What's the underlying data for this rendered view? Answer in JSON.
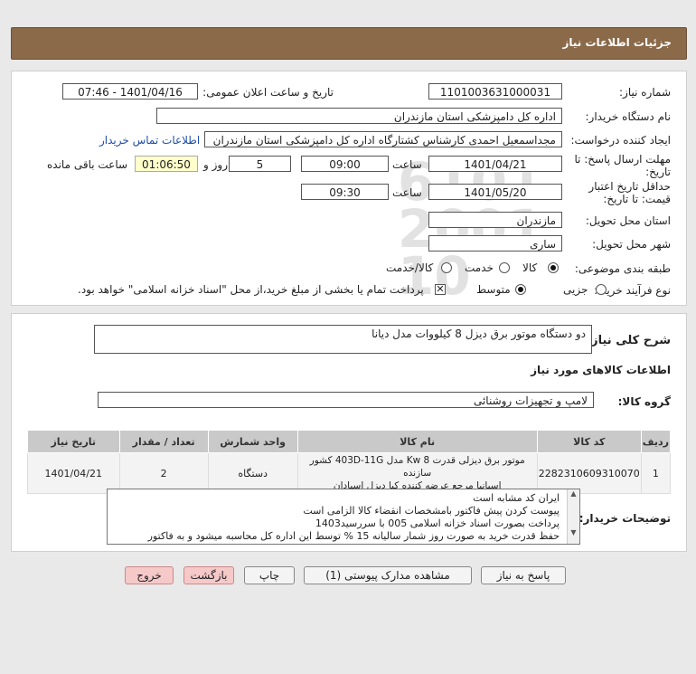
{
  "header": {
    "title": "جزئیات اطلاعات نیاز"
  },
  "form": {
    "need_number_label": "شماره نیاز:",
    "need_number": "1101003631000031",
    "announce_label": "تاریخ و ساعت اعلان عمومی:",
    "announce_value": "1401/04/16 - 07:46",
    "buyer_label": "نام دستگاه خریدار:",
    "buyer_value": "اداره کل دامپزشکی استان مازندران",
    "creator_label": "ایجاد کننده درخواست:",
    "creator_value": "مجداسمعیل احمدی کارشناس کشتارگاه اداره کل دامپزشکی استان مازندران",
    "contact_link": "اطلاعات تماس خریدار",
    "deadline_label_1": "مهلت ارسال پاسخ: تا",
    "deadline_label_2": "تاریخ:",
    "deadline_date": "1401/04/21",
    "time_label": "ساعت",
    "deadline_time": "09:00",
    "days_value": "5",
    "days_label": "روز و",
    "timer_value": "01:06:50",
    "remaining_label": "ساعت باقی مانده",
    "validity_label_1": "حداقل تاریخ اعتبار",
    "validity_label_2": "قیمت: تا تاریخ:",
    "validity_date": "1401/05/20",
    "validity_time": "09:30",
    "province_label": "استان محل تحویل:",
    "province_value": "مازندران",
    "city_label": "شهر محل تحویل:",
    "city_value": "ساری",
    "category_label": "طبقه بندی موضوعی:",
    "category_options": [
      "کالا",
      "خدمت",
      "کالا/خدمت"
    ],
    "process_label": "نوع فرآیند خرید :",
    "process_options": [
      "جزیی",
      "متوسط"
    ],
    "payment_note": "پرداخت تمام یا بخشی از مبلغ خرید،از محل \"اسناد خزانه اسلامی\" خواهد بود."
  },
  "summary": {
    "label": "شرح کلی نیاز:",
    "value": "دو دستگاه موتور برق دیزل 8  کیلووات مدل دیانا"
  },
  "goods_section_title": "اطلاعات کالاهای مورد نیاز",
  "goods_group": {
    "label": "گروه کالا:",
    "value": "لامپ و تجهیزات روشنائی"
  },
  "table": {
    "headers": [
      "ردیف",
      "کد کالا",
      "نام کالا",
      "واحد شمارش",
      "تعداد / مقدار",
      "تاریخ نیاز"
    ],
    "rows": [
      {
        "index": "1",
        "code": "2282310609310070",
        "name_line1": "موتور برق دیزلی قدرت Kw 8 مدل 403D-11G کشور سازنده",
        "name_line2": "اسپانیا مرجع عرضه کننده کیا دیزل اسپادان",
        "unit": "دستگاه",
        "qty": "2",
        "date": "1401/04/21"
      }
    ]
  },
  "buyer_notes": {
    "label": "توضیحات خریدار:",
    "lines": [
      "ایران کد مشابه است",
      "پیوست کردن پیش فاکتور بامشخصات انقضاء کالا الزامی است",
      "پرداخت بصورت اسناد خزانه اسلامی 005 با سررسید1403",
      "حفظ قدرت خرید به صورت روز شمار سالیانه 15 % توسط این اداره کل محاسبه میشود و به فاکتور"
    ]
  },
  "buttons": {
    "reply": "پاسخ به نیاز",
    "attachments": "مشاهده مدارک پیوستی (1)",
    "print": "چاپ",
    "back": "بازگشت",
    "exit": "خروج"
  },
  "watermark": {
    "brand": "ParsNamadData"
  }
}
